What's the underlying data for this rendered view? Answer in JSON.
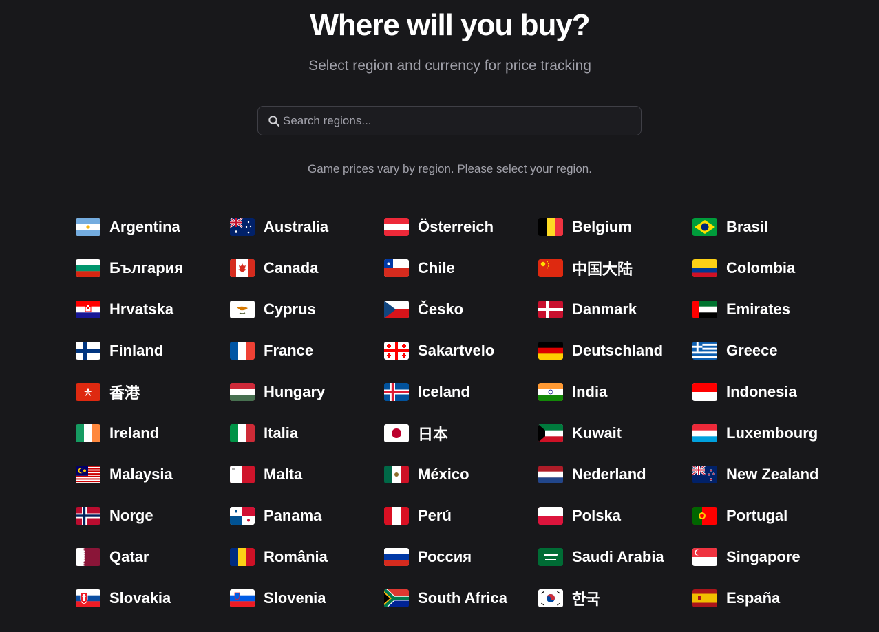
{
  "header": {
    "title": "Where will you buy?",
    "subtitle": "Select region and currency for price tracking"
  },
  "search": {
    "placeholder": "Search regions...",
    "value": "",
    "icon": "search-icon"
  },
  "notice": "Game prices vary by region. Please select your region.",
  "regions": [
    {
      "name": "Argentina",
      "flag": "flag-ar"
    },
    {
      "name": "Australia",
      "flag": "flag-au"
    },
    {
      "name": "Österreich",
      "flag": "flag-at"
    },
    {
      "name": "Belgium",
      "flag": "flag-be"
    },
    {
      "name": "Brasil",
      "flag": "flag-br"
    },
    {
      "name": "България",
      "flag": "flag-bg"
    },
    {
      "name": "Canada",
      "flag": "flag-ca"
    },
    {
      "name": "Chile",
      "flag": "flag-cl"
    },
    {
      "name": "中国大陆",
      "flag": "flag-cn"
    },
    {
      "name": "Colombia",
      "flag": "flag-co"
    },
    {
      "name": "Hrvatska",
      "flag": "flag-hr"
    },
    {
      "name": "Cyprus",
      "flag": "flag-cy"
    },
    {
      "name": "Česko",
      "flag": "flag-cz"
    },
    {
      "name": "Danmark",
      "flag": "flag-dk"
    },
    {
      "name": "Emirates",
      "flag": "flag-ae"
    },
    {
      "name": "Finland",
      "flag": "flag-fi"
    },
    {
      "name": "France",
      "flag": "flag-fr"
    },
    {
      "name": "Sakartvelo",
      "flag": "flag-ge"
    },
    {
      "name": "Deutschland",
      "flag": "flag-de"
    },
    {
      "name": "Greece",
      "flag": "flag-gr"
    },
    {
      "name": "香港",
      "flag": "flag-hk"
    },
    {
      "name": "Hungary",
      "flag": "flag-hu"
    },
    {
      "name": "Iceland",
      "flag": "flag-is"
    },
    {
      "name": "India",
      "flag": "flag-in"
    },
    {
      "name": "Indonesia",
      "flag": "flag-id"
    },
    {
      "name": "Ireland",
      "flag": "flag-ie"
    },
    {
      "name": "Italia",
      "flag": "flag-it"
    },
    {
      "name": "日本",
      "flag": "flag-jp"
    },
    {
      "name": "Kuwait",
      "flag": "flag-kw"
    },
    {
      "name": "Luxembourg",
      "flag": "flag-lu"
    },
    {
      "name": "Malaysia",
      "flag": "flag-my"
    },
    {
      "name": "Malta",
      "flag": "flag-mt"
    },
    {
      "name": "México",
      "flag": "flag-mx"
    },
    {
      "name": "Nederland",
      "flag": "flag-nl"
    },
    {
      "name": "New Zealand",
      "flag": "flag-nz"
    },
    {
      "name": "Norge",
      "flag": "flag-no"
    },
    {
      "name": "Panama",
      "flag": "flag-pa"
    },
    {
      "name": "Perú",
      "flag": "flag-pe"
    },
    {
      "name": "Polska",
      "flag": "flag-pl"
    },
    {
      "name": "Portugal",
      "flag": "flag-pt"
    },
    {
      "name": "Qatar",
      "flag": "flag-qa"
    },
    {
      "name": "România",
      "flag": "flag-ro"
    },
    {
      "name": "Россия",
      "flag": "flag-ru"
    },
    {
      "name": "Saudi Arabia",
      "flag": "flag-sa"
    },
    {
      "name": "Singapore",
      "flag": "flag-sg"
    },
    {
      "name": "Slovakia",
      "flag": "flag-sk"
    },
    {
      "name": "Slovenia",
      "flag": "flag-si"
    },
    {
      "name": "South Africa",
      "flag": "flag-za"
    },
    {
      "name": "한국",
      "flag": "flag-kr"
    },
    {
      "name": "España",
      "flag": "flag-es"
    }
  ]
}
